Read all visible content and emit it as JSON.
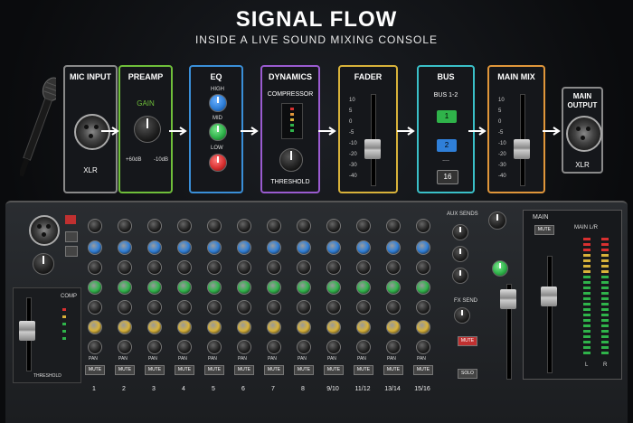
{
  "header": {
    "title": "SIGNAL FLOW",
    "subtitle": "INSIDE A LIVE SOUND MIXING CONSOLE"
  },
  "blocks": {
    "mic_input": {
      "title": "MIC INPUT",
      "connector": "XLR"
    },
    "preamp": {
      "title": "PREAMP",
      "knob_label": "GAIN",
      "min": "+60dB",
      "max": "-10dB"
    },
    "eq": {
      "title": "EQ",
      "high": "HIGH",
      "mid": "MID",
      "low": "LOW"
    },
    "dynamics": {
      "title": "DYNAMICS",
      "sub": "COMPRESSOR",
      "knob_label": "THRESHOLD"
    },
    "fader": {
      "title": "FADER",
      "scale": [
        "10",
        "5",
        "0",
        "-5",
        "-10",
        "-20",
        "-30",
        "-40"
      ]
    },
    "bus": {
      "title": "BUS",
      "sub": "BUS 1-2",
      "buttons": [
        "1",
        "2",
        "16"
      ],
      "dots": "...."
    },
    "main_mix": {
      "title": "MAIN MIX",
      "scale": [
        "10",
        "5",
        "0",
        "-5",
        "-10",
        "-20",
        "-30",
        "-40"
      ]
    },
    "main_output": {
      "title": "MAIN OUTPUT",
      "connector": "XLR"
    }
  },
  "console": {
    "channel_labels": [
      "1",
      "2",
      "3",
      "4",
      "5",
      "6",
      "7",
      "8",
      "9/10",
      "11/12",
      "13/14",
      "15/16"
    ],
    "mute": "MUTE",
    "pan": "PAN",
    "aux_sends": "AUX SENDS",
    "fx_send": "FX SEND",
    "main": "MAIN",
    "main_lr": "MAIN L/R",
    "comp": "COMP",
    "threshold": "THRESHOLD",
    "solo": "SOLO",
    "l": "L",
    "r": "R",
    "colors": {
      "green": "#2fb34a",
      "blue": "#2f7fd8",
      "red": "#d83030",
      "yellow": "#d8b23a"
    }
  }
}
